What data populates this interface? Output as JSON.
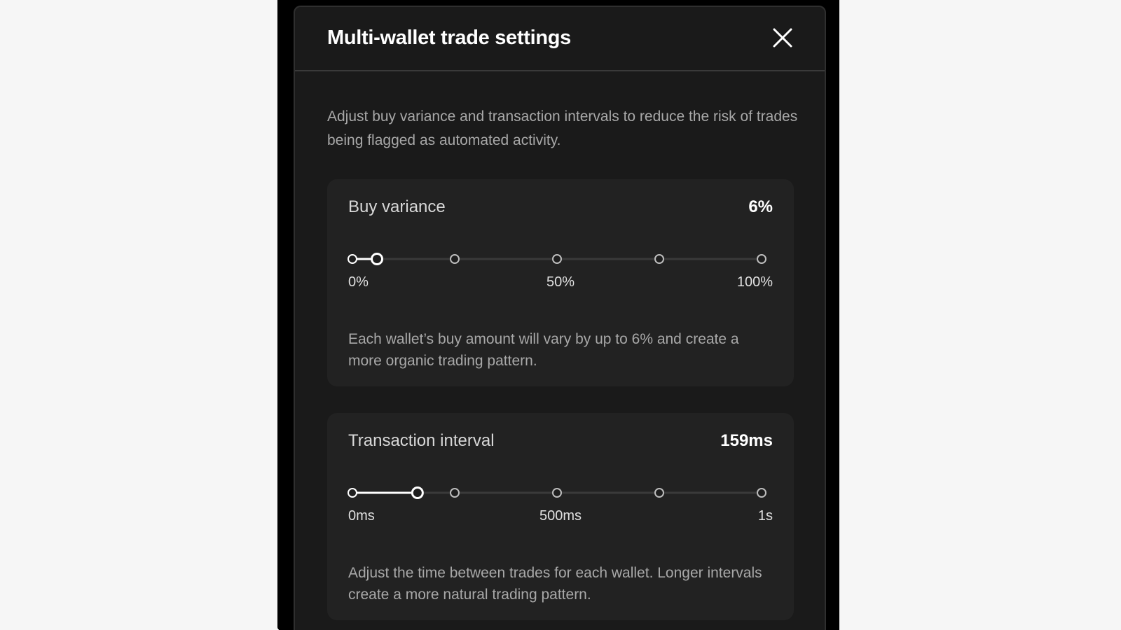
{
  "modal": {
    "title": "Multi-wallet trade settings",
    "close_icon": "close-icon",
    "description": "Adjust buy variance and transaction intervals to reduce the risk of trades being flagged as automated activity."
  },
  "buy_variance": {
    "title": "Buy variance",
    "value": "6%",
    "slider_fraction": 0.06,
    "tick_labels": [
      "0%",
      "50%",
      "100%"
    ],
    "help": "Each wallet’s buy amount will vary by up to 6% and create a more organic trading pattern."
  },
  "transaction_interval": {
    "title": "Transaction interval",
    "value": "159ms",
    "slider_fraction": 0.159,
    "tick_labels": [
      "0ms",
      "500ms",
      "1s"
    ],
    "help": "Adjust the time between trades for each wallet. Longer intervals create a more natural trading pattern."
  },
  "colors": {
    "modal_bg": "#1a1a1a",
    "card_bg": "#222222",
    "track": "#3a3a3a",
    "fill": "#ffffff"
  }
}
